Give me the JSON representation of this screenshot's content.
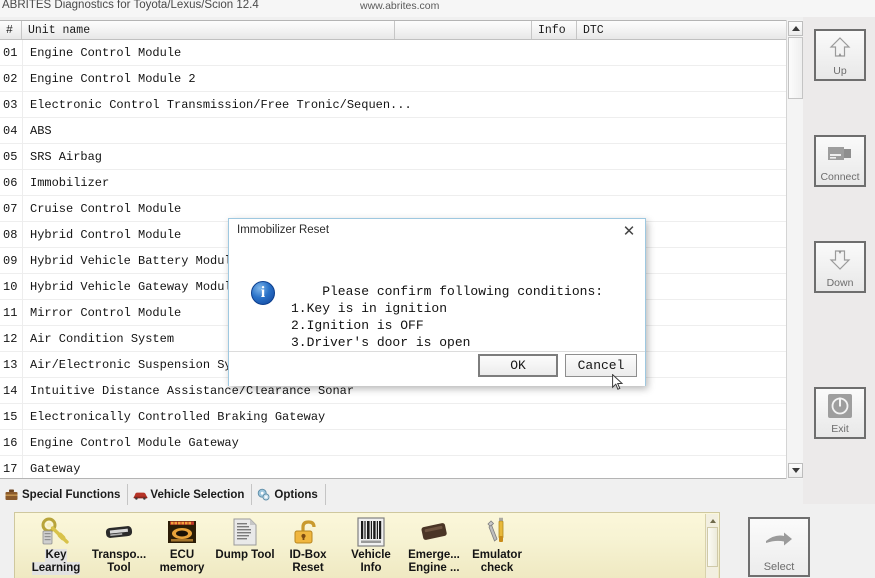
{
  "titlebar": {
    "app_title": "ABRITES Diagnostics for Toyota/Lexus/Scion 12.4",
    "website": "www.abrites.com"
  },
  "list": {
    "columns": [
      "#",
      "Unit name",
      "Info",
      "DTC",
      ""
    ],
    "rows": [
      {
        "idx": "01",
        "name": "Engine Control Module",
        "info": "",
        "dtc": ""
      },
      {
        "idx": "02",
        "name": "Engine Control Module 2",
        "info": "",
        "dtc": ""
      },
      {
        "idx": "03",
        "name": "Electronic Control Transmission/Free Tronic/Sequen...",
        "info": "",
        "dtc": ""
      },
      {
        "idx": "04",
        "name": "ABS",
        "info": "",
        "dtc": ""
      },
      {
        "idx": "05",
        "name": "SRS Airbag",
        "info": "",
        "dtc": ""
      },
      {
        "idx": "06",
        "name": "Immobilizer",
        "info": "",
        "dtc": ""
      },
      {
        "idx": "07",
        "name": "Cruise Control Module",
        "info": "",
        "dtc": ""
      },
      {
        "idx": "08",
        "name": "Hybrid Control Module",
        "info": "",
        "dtc": ""
      },
      {
        "idx": "09",
        "name": "Hybrid Vehicle Battery Module",
        "info": "",
        "dtc": ""
      },
      {
        "idx": "10",
        "name": "Hybrid Vehicle Gateway Module",
        "info": "",
        "dtc": ""
      },
      {
        "idx": "11",
        "name": "Mirror Control Module",
        "info": "",
        "dtc": ""
      },
      {
        "idx": "12",
        "name": "Air Condition System",
        "info": "",
        "dtc": ""
      },
      {
        "idx": "13",
        "name": "Air/Electronic Suspension Sys",
        "info": "",
        "dtc": ""
      },
      {
        "idx": "14",
        "name": "Intuitive Distance Assistance/Clearance Sonar",
        "info": "",
        "dtc": ""
      },
      {
        "idx": "15",
        "name": "Electronically Controlled Braking Gateway",
        "info": "",
        "dtc": ""
      },
      {
        "idx": "16",
        "name": "Engine Control Module Gateway",
        "info": "",
        "dtc": ""
      },
      {
        "idx": "17",
        "name": "Gateway",
        "info": "",
        "dtc": ""
      }
    ]
  },
  "sidebar": {
    "buttons": [
      {
        "label": "Up",
        "icon": "arrow-up-icon"
      },
      {
        "label": "Connect",
        "icon": "connector-icon"
      },
      {
        "label": "Down",
        "icon": "arrow-down-icon"
      },
      {
        "label": "Exit",
        "icon": "power-icon"
      }
    ]
  },
  "dialog": {
    "title": "Immobilizer Reset",
    "close_label": "✕",
    "icon": "info-icon",
    "message": "    Please confirm following conditions:\n1.Key is in ignition\n2.Ignition is OFF\n3.Driver's door is open",
    "ok_label": "OK",
    "cancel_label": "Cancel"
  },
  "tabs": [
    {
      "label": "Special Functions",
      "icon": "toolbox-icon",
      "active": true
    },
    {
      "label": "Vehicle Selection",
      "icon": "car-icon",
      "active": false
    },
    {
      "label": "Options",
      "icon": "gears-icon",
      "active": false
    }
  ],
  "toolbar": {
    "items": [
      {
        "line1": "Key",
        "line2": "Learning",
        "icon": "key-icon",
        "selected": true
      },
      {
        "line1": "Transpo...",
        "line2": "Tool",
        "icon": "transponder-icon",
        "selected": false
      },
      {
        "line1": "ECU",
        "line2": "memory",
        "icon": "ecu-memory-icon",
        "selected": false
      },
      {
        "line1": "Dump Tool",
        "line2": "",
        "icon": "dump-file-icon",
        "selected": false
      },
      {
        "line1": "ID-Box",
        "line2": "Reset",
        "icon": "padlock-open-icon",
        "selected": false
      },
      {
        "line1": "Vehicle",
        "line2": "Info",
        "icon": "barcode-icon",
        "selected": false
      },
      {
        "line1": "Emerge...",
        "line2": "Engine ...",
        "icon": "chip-icon",
        "selected": false
      },
      {
        "line1": "Emulator",
        "line2": "check",
        "icon": "tools-icon",
        "selected": false
      }
    ]
  },
  "select_button": {
    "label": "Select",
    "icon": "arrow-right-icon"
  },
  "colors": {
    "toolbar_bg": "#f7f3d3",
    "dialog_border": "#9ec8e0",
    "info_blue": "#2a72c8",
    "tab_text": "#1b1b1b"
  }
}
